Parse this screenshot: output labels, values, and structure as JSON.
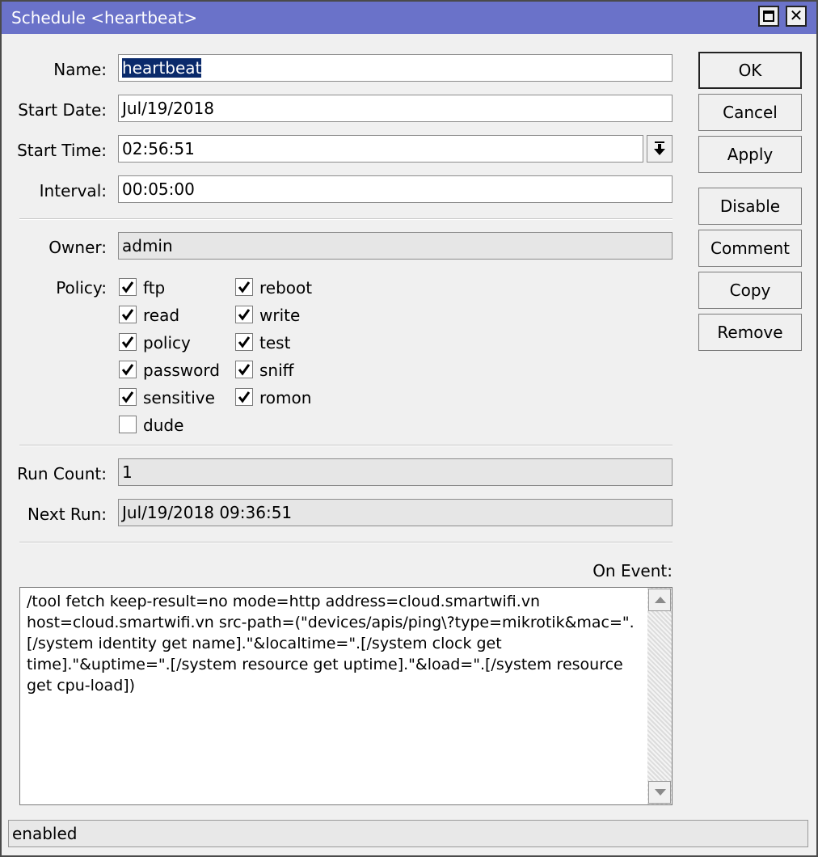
{
  "window": {
    "title": "Schedule <heartbeat>"
  },
  "form": {
    "name_label": "Name:",
    "name_value": "heartbeat",
    "start_date_label": "Start Date:",
    "start_date_value": "Jul/19/2018",
    "start_time_label": "Start Time:",
    "start_time_value": "02:56:51",
    "interval_label": "Interval:",
    "interval_value": "00:05:00",
    "owner_label": "Owner:",
    "owner_value": "admin",
    "policy_label": "Policy:",
    "run_count_label": "Run Count:",
    "run_count_value": "1",
    "next_run_label": "Next Run:",
    "next_run_value": "Jul/19/2018 09:36:51",
    "on_event_label": "On Event:",
    "on_event_script": "/tool fetch keep-result=no mode=http address=cloud.smartwifi.vn host=cloud.smartwifi.vn src-path=(\"devices/apis/ping\\?type=mikrotik&mac=\".[/system identity get name].\"&localtime=\".[/system clock get time].\"&uptime=\".[/system resource get uptime].\"&load=\".[/system resource get cpu-load])"
  },
  "policy": {
    "col1": [
      {
        "label": "ftp",
        "checked": true
      },
      {
        "label": "read",
        "checked": true
      },
      {
        "label": "policy",
        "checked": true
      },
      {
        "label": "password",
        "checked": true
      },
      {
        "label": "sensitive",
        "checked": true
      },
      {
        "label": "dude",
        "checked": false
      }
    ],
    "col2": [
      {
        "label": "reboot",
        "checked": true
      },
      {
        "label": "write",
        "checked": true
      },
      {
        "label": "test",
        "checked": true
      },
      {
        "label": "sniff",
        "checked": true
      },
      {
        "label": "romon",
        "checked": true
      }
    ]
  },
  "buttons": {
    "ok": "OK",
    "cancel": "Cancel",
    "apply": "Apply",
    "disable": "Disable",
    "comment": "Comment",
    "copy": "Copy",
    "remove": "Remove"
  },
  "status": {
    "text": "enabled"
  },
  "icons": {
    "maximize": "maximize-icon",
    "close": "close-icon",
    "dropdown": "dropdown-arrow-icon",
    "check": "checkmark-icon",
    "scroll_up": "scroll-up-arrow-icon",
    "scroll_down": "scroll-down-arrow-icon"
  }
}
